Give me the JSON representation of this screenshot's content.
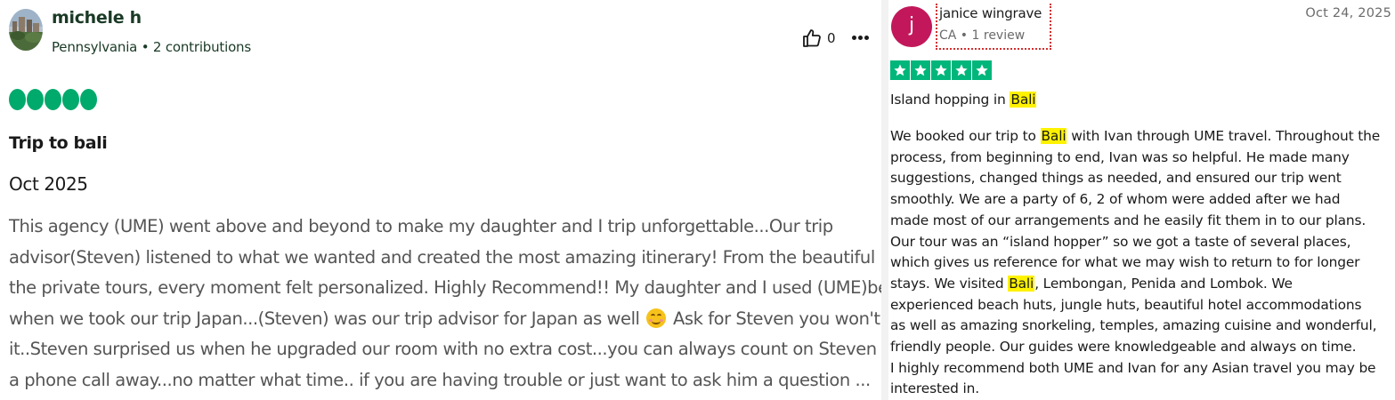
{
  "left_review": {
    "author": "michele h",
    "meta": "Pennsylvania • 2 contributions",
    "helpful_count": "0",
    "rating": 5,
    "title": "Trip to bali",
    "date": "Oct 2025",
    "body_lines": [
      "This agency (UME) went above and beyond to make my daughter and I trip unforgettable...Our trip",
      "advisor(Steven) listened to what we wanted and created the most amazing itinerary! From the beautiful resort to",
      "the private tours, every moment felt personalized. Highly Recommend!! My daughter and I used (UME)before",
      "it..Steven surprised us when he upgraded our room with no extra cost...you can always count on Steven he's only",
      "a phone call away...no matter what time.. if you are having trouble or just want to ask him a question ..."
    ],
    "body_line4_before": "when we took our trip Japan...(Steven) was our trip advisor for Japan as well",
    "body_line4_after": "Ask for Steven you won't regret",
    "icons": {
      "helpful": "thumbs-up-icon",
      "more": "more-options-icon",
      "emoji": "smiling-face-icon"
    },
    "colors": {
      "bubble": "#00aa6c",
      "name": "#1a3a26"
    }
  },
  "right_review": {
    "avatar_letter": "j",
    "author": "janice wingrave",
    "meta": "CA • 1 review",
    "date": "Oct 24, 2025",
    "rating": 5,
    "title_before": "Island hopping in",
    "title_highlight": "Bali",
    "body": {
      "l1_a": "We booked our trip to",
      "l1_h": "Bali",
      "l1_b": "with Ivan through UME travel. Throughout the",
      "l2": "process, from beginning to end, Ivan was so helpful. He made many",
      "l3": "suggestions, changed things as needed, and ensured our trip went",
      "l4": "smoothly. We are a party of 6, 2 of whom were added after we had",
      "l5": "made most of our arrangements and he easily fit them in to our plans.",
      "l6": "Our tour was an “island hopper” so we got a taste of several places,",
      "l7": "which gives us reference for what we may wish to return to for longer",
      "l8_a": "stays. We visited",
      "l8_h": "Bali",
      "l8_b": ", Lembongan, Penida and Lombok. We",
      "l9": "experienced beach huts, jungle huts, beautiful hotel accommodations",
      "l10": "as well as amazing snorkeling, temples, amazing cuisine and wonderful,",
      "l11": "friendly people. Our guides were knowledgeable and always on time.",
      "l12": "I highly recommend both UME and Ivan for any Asian travel you may be",
      "l13": "interested in."
    },
    "colors": {
      "star": "#00b67a",
      "avatar": "#c2185b",
      "highlight": "#fff200"
    }
  }
}
